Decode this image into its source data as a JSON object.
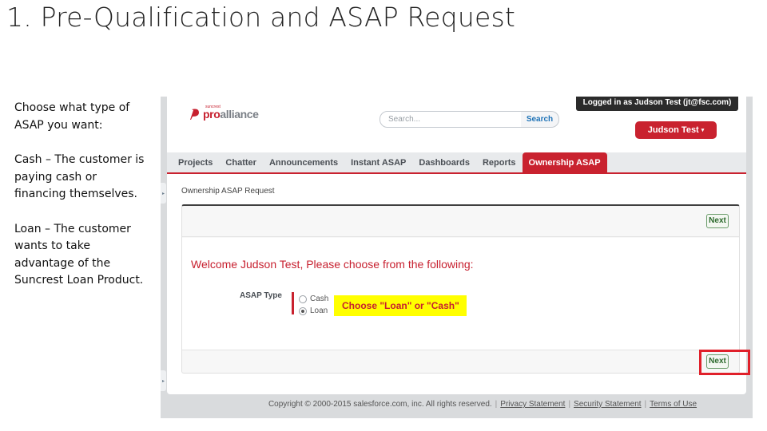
{
  "slide": {
    "title": "1. Pre-Qualification and ASAP Request",
    "notes": [
      "Choose what type of ASAP you want:",
      "Cash – The customer is paying cash or financing themselves.",
      "Loan – The customer wants to take advantage of the Suncrest Loan Product."
    ]
  },
  "app": {
    "logo": {
      "small_text": "suncrest",
      "pro": "pro",
      "alliance": "alliance",
      "icon": "proalliance-logo-icon"
    },
    "search": {
      "placeholder": "Search...",
      "button_label": "Search"
    },
    "logged_in_text": "Logged in as Judson Test (jt@fsc.com)",
    "user_menu": {
      "label": "Judson Test",
      "caret": "▾"
    },
    "tabs": [
      {
        "label": "Projects"
      },
      {
        "label": "Chatter"
      },
      {
        "label": "Announcements"
      },
      {
        "label": "Instant ASAP"
      },
      {
        "label": "Dashboards"
      },
      {
        "label": "Reports"
      },
      {
        "label": "Ownership ASAP",
        "active": true
      }
    ],
    "page_heading": "Ownership ASAP Request",
    "form": {
      "welcome": "Welcome Judson Test, Please choose from the following:",
      "field_label": "ASAP Type",
      "options": [
        {
          "label": "Cash",
          "selected": false
        },
        {
          "label": "Loan",
          "selected": true
        }
      ],
      "callout": "Choose \"Loan\" or \"Cash\"",
      "next_label": "Next"
    },
    "footer": {
      "copyright": "Copyright © 2000-2015 salesforce.com, inc. All rights reserved.",
      "links": [
        "Privacy Statement",
        "Security Statement",
        "Terms of Use"
      ],
      "separator": "|"
    },
    "colors": {
      "brand_red": "#c9222f",
      "highlight_yellow": "#ffff00",
      "next_green": "#2d6a2d"
    }
  }
}
